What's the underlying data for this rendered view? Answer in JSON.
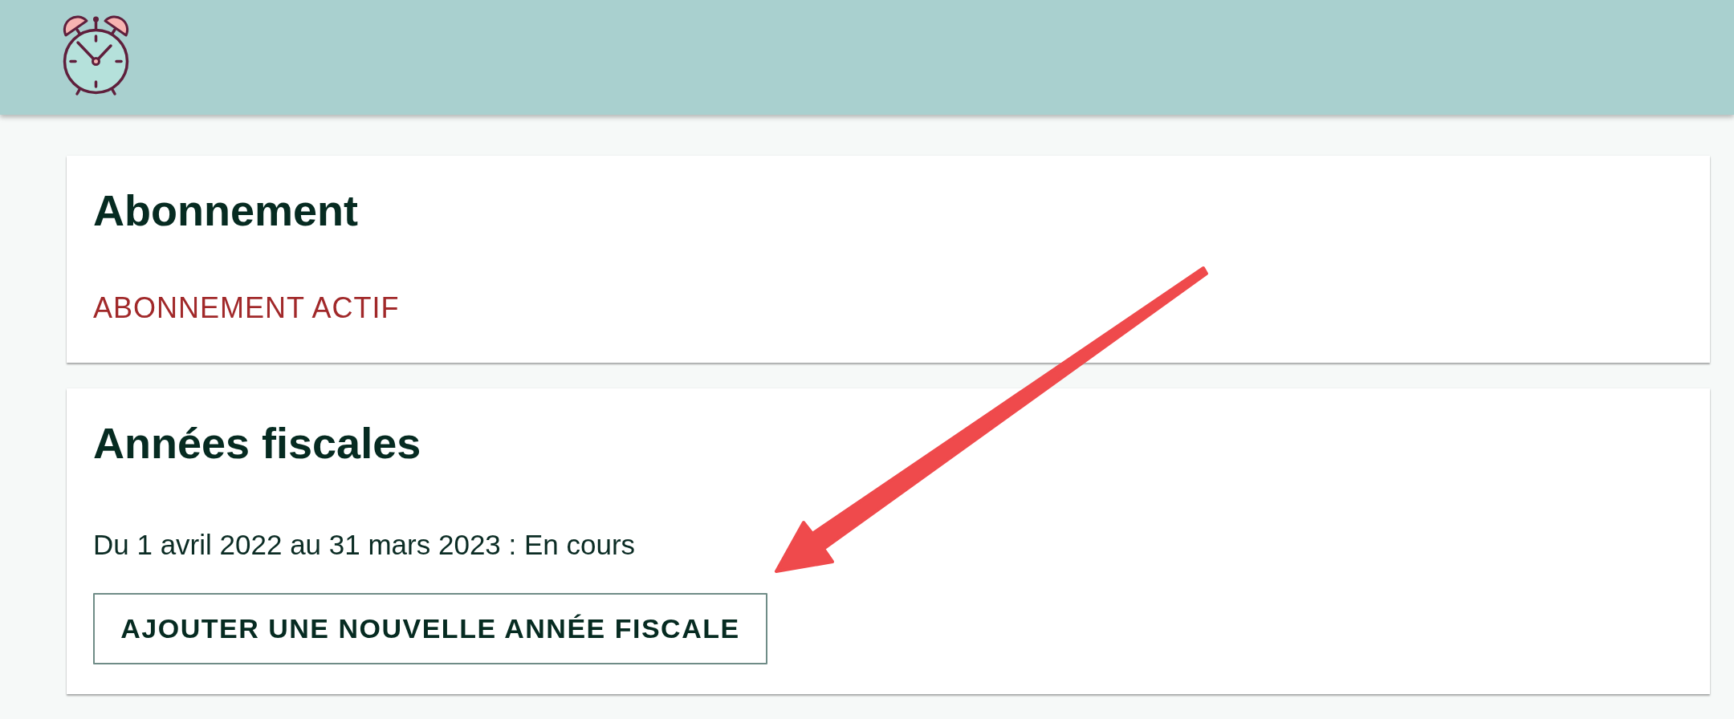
{
  "subscription_card": {
    "title": "Abonnement",
    "status": "ABONNEMENT ACTIF"
  },
  "fiscal_years_card": {
    "title": "Années fiscales",
    "years": [
      "Du 1 avril 2022 au 31 mars 2023 : En cours"
    ],
    "add_button": "AJOUTER UNE NOUVELLE ANNÉE FISCALE"
  }
}
